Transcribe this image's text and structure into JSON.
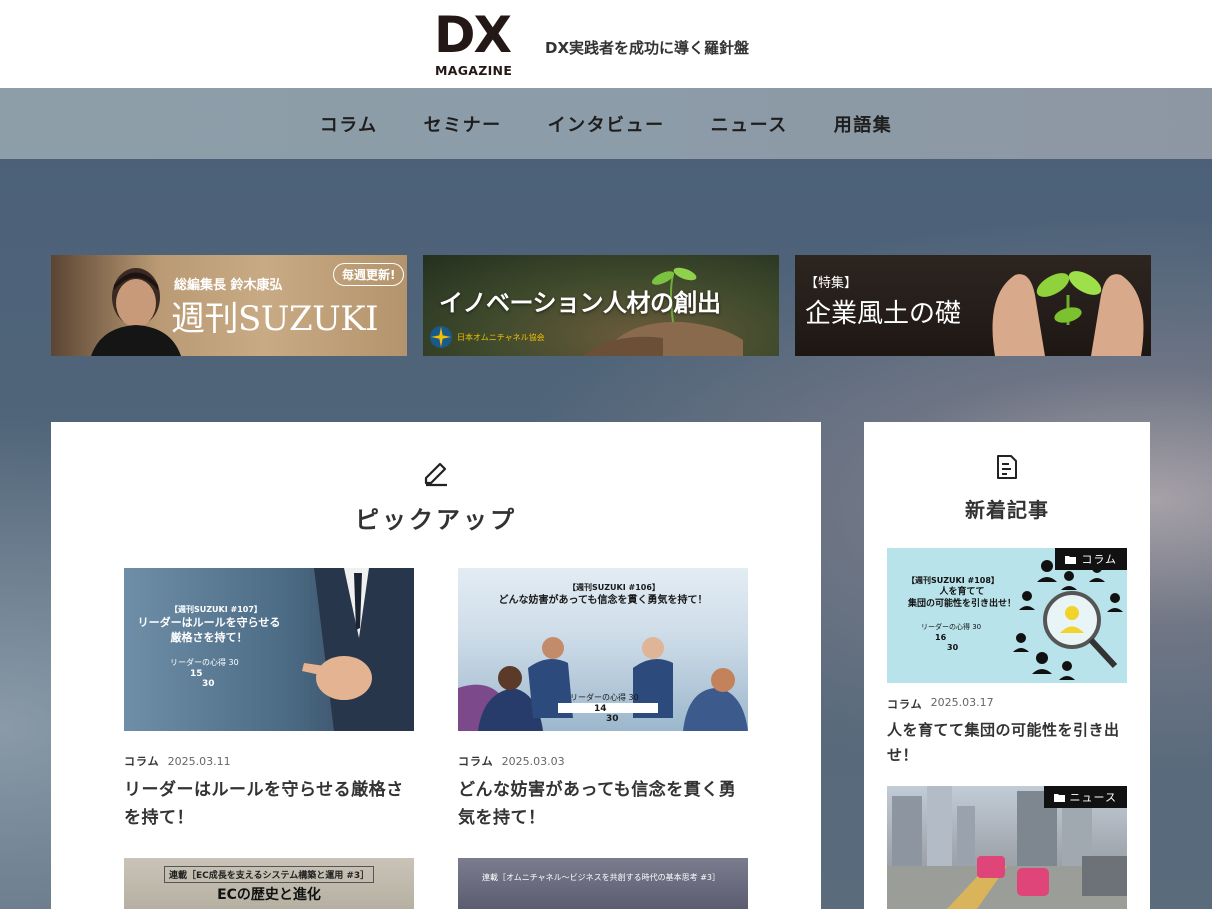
{
  "header": {
    "logo_main": "DX",
    "logo_sub": "MAGAZINE",
    "tagline": "DX実践者を成功に導く羅針盤"
  },
  "nav": {
    "items": [
      "コラム",
      "セミナー",
      "インタビュー",
      "ニュース",
      "用語集"
    ]
  },
  "banners": [
    {
      "subtitle": "総編集長 鈴木康弘",
      "pill": "毎週更新!",
      "title": "週刊SUZUKI"
    },
    {
      "title": "イノベーション人材の創出",
      "org": "日本オムニチャネル協会"
    },
    {
      "tag": "【特集】",
      "title": "企業風土の礎"
    }
  ],
  "pickup": {
    "heading": "ピックアップ",
    "icon": "pencil-icon",
    "cards": [
      {
        "thumb_tag": "【週刊SUZUKI #107】",
        "thumb_title_1": "リーダーはルールを守らせる",
        "thumb_title_2": "厳格さを持て！",
        "thumb_series": "リーダーの心得 30",
        "thumb_num": "15",
        "thumb_den": "30",
        "category": "コラム",
        "date": "2025.03.11",
        "title": "リーダーはルールを守らせる厳格さを持て！"
      },
      {
        "thumb_tag": "【週刊SUZUKI #106】",
        "thumb_title_1": "どんな妨害があっても信念を貫く勇気を持て！",
        "thumb_series": "リーダーの心得 30",
        "thumb_num": "14",
        "thumb_den": "30",
        "category": "コラム",
        "date": "2025.03.03",
        "title": "どんな妨害があっても信念を貫く勇気を持て！"
      },
      {
        "thumb_tag": "連載［EC成長を支えるシステム構築と運用 #3］",
        "thumb_title_1": "ECの歴史と進化"
      },
      {
        "thumb_tag": "連載［オムニチャネル〜ビジネスを共創する時代の基本思考 #3］"
      }
    ]
  },
  "latest": {
    "heading": "新着記事",
    "icon": "document-icon",
    "cards": [
      {
        "label": "コラム",
        "thumb_tag": "【週刊SUZUKI #108】",
        "thumb_title_1": "人を育てて",
        "thumb_title_2": "集団の可能性を引き出せ！",
        "thumb_series": "リーダーの心得 30",
        "thumb_num": "16",
        "thumb_den": "30",
        "category": "コラム",
        "date": "2025.03.17",
        "title": "人を育てて集団の可能性を引き出せ！"
      },
      {
        "label": "ニュース"
      }
    ]
  },
  "colors": {
    "header_bg": "#ffffff",
    "nav_bg": "#8e9ea9",
    "page_bg": "#4f6479",
    "panel_bg": "#ffffff",
    "label_bg": "#111111"
  }
}
